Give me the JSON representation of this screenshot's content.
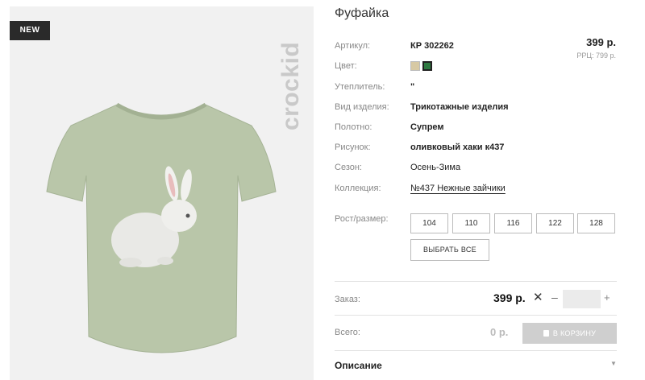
{
  "badge": "NEW",
  "brand": "crockid",
  "product": {
    "title": "Фуфайка",
    "price": "399 р.",
    "rrp": "РРЦ: 799 р."
  },
  "attributes": {
    "article_label": "Артикул:",
    "article_value": "КР 302262",
    "color_label": "Цвет:",
    "insulation_label": "Утеплитель:",
    "insulation_value": "\"",
    "type_label": "Вид изделия:",
    "type_value": "Трикотажные изделия",
    "fabric_label": "Полотно:",
    "fabric_value": "Супрем",
    "pattern_label": "Рисунок:",
    "pattern_value": "оливковый хаки к437",
    "season_label": "Сезон:",
    "season_value": "Осень-Зима",
    "collection_label": "Коллекция:",
    "collection_value": "№437 Нежные зайчики"
  },
  "colors": [
    "#d7c9a4",
    "#2f7a42"
  ],
  "sizes": {
    "label": "Рост/размер:",
    "options": [
      "104",
      "110",
      "116",
      "122",
      "128"
    ],
    "select_all": "ВЫБРАТЬ ВСЕ"
  },
  "order": {
    "label": "Заказ:",
    "price": "399 р.",
    "times": "✕",
    "minus": "–",
    "plus": "+",
    "quantity": ""
  },
  "total": {
    "label": "Всего:",
    "value": "0 р.",
    "cart_button": "В КОРЗИНУ"
  },
  "description": {
    "label": "Описание",
    "chevron": "▼"
  }
}
